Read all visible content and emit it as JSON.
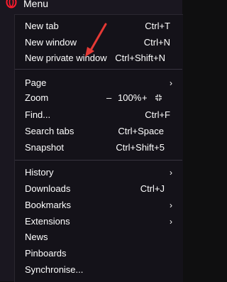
{
  "header": {
    "title": "Menu"
  },
  "items": {
    "new_tab": {
      "label": "New tab",
      "shortcut": "Ctrl+T"
    },
    "new_window": {
      "label": "New window",
      "shortcut": "Ctrl+N"
    },
    "new_private_window": {
      "label": "New private window",
      "shortcut": "Ctrl+Shift+N"
    },
    "page": {
      "label": "Page"
    },
    "zoom": {
      "label": "Zoom",
      "minus": "–",
      "value": "100%",
      "plus": "+",
      "fullscreen_icon": "fullscreen-icon"
    },
    "find": {
      "label": "Find...",
      "shortcut": "Ctrl+F"
    },
    "search_tabs": {
      "label": "Search tabs",
      "shortcut": "Ctrl+Space"
    },
    "snapshot": {
      "label": "Snapshot",
      "shortcut": "Ctrl+Shift+5"
    },
    "history": {
      "label": "History"
    },
    "downloads": {
      "label": "Downloads",
      "shortcut": "Ctrl+J"
    },
    "bookmarks": {
      "label": "Bookmarks"
    },
    "extensions": {
      "label": "Extensions"
    },
    "news": {
      "label": "News"
    },
    "pinboards": {
      "label": "Pinboards"
    },
    "synchronise": {
      "label": "Synchronise..."
    }
  },
  "colors": {
    "background": "#141219",
    "text": "#ffffff",
    "annotation_arrow": "#e53935",
    "logo": "#ff1b2d"
  }
}
